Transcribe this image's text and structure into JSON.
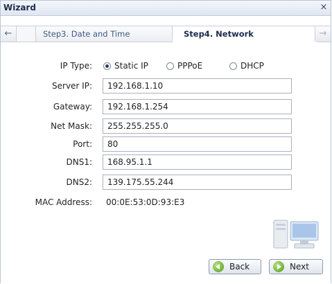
{
  "window": {
    "title": "Wizard",
    "close_glyph": "×"
  },
  "tabs": {
    "prev_arrow": "←",
    "next_arrow": "→",
    "previous": "Step3. Date and Time",
    "active": "Step4. Network"
  },
  "form": {
    "ip_type": {
      "label": "IP Type:",
      "options": [
        "Static IP",
        "PPPoE",
        "DHCP"
      ],
      "selected": "Static IP"
    },
    "server_ip": {
      "label": "Server IP:",
      "value": "192.168.1.10"
    },
    "gateway": {
      "label": "Gateway:",
      "value": "192.168.1.254"
    },
    "net_mask": {
      "label": "Net Mask:",
      "value": "255.255.255.0"
    },
    "port": {
      "label": "Port:",
      "value": "80"
    },
    "dns1": {
      "label": "DNS1:",
      "value": "168.95.1.1"
    },
    "dns2": {
      "label": "DNS2:",
      "value": "139.175.55.244"
    },
    "mac": {
      "label": "MAC Address:",
      "value": "00:0E:53:0D:93:E3"
    }
  },
  "buttons": {
    "back": "Back",
    "next": "Next"
  },
  "icons": {
    "network": "network-computers-icon",
    "back": "back-arrow-icon",
    "next": "next-arrow-icon",
    "close": "close-icon"
  },
  "colors": {
    "title": "#1d2d4d",
    "tab_link": "#3e5a86",
    "button_icon": "#4d9b1c"
  }
}
